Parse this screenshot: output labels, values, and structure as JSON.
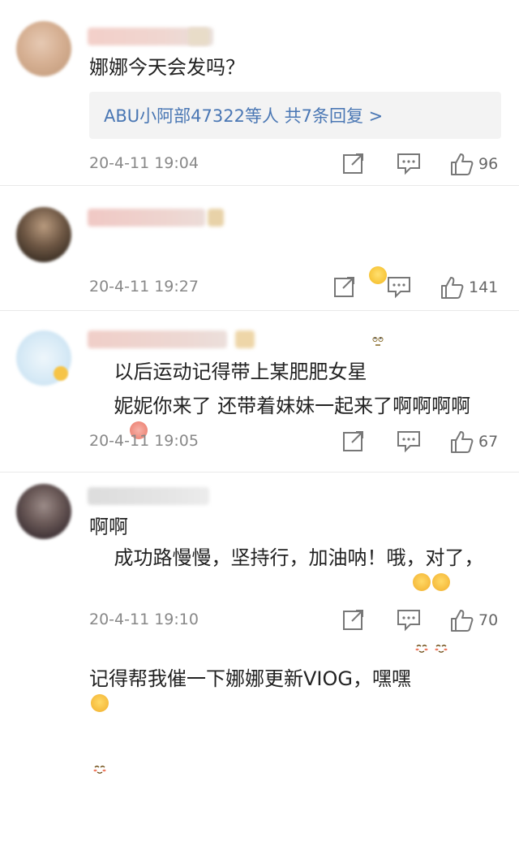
{
  "comments": [
    {
      "text": "娜娜今天会发吗？",
      "reply_summary": "ABU小阿部47322等人  共7条回复 >",
      "time": "20-4-11 19:04",
      "likes": "96"
    },
    {
      "text": "以后运动记得带上某肥肥女星",
      "time": "20-4-11 19:27",
      "likes": "141"
    },
    {
      "text": "妮妮你来了 还带着妹妹一起来了啊啊啊啊\n啊啊",
      "time": "20-4-11 19:05",
      "likes": "67"
    },
    {
      "text": "成功路慢慢，坚持行，加油呐！哦，对了，\n记得帮我催一下娜娜更新VIOG，嘿嘿",
      "time": "20-4-11 19:10",
      "likes": "70"
    }
  ],
  "colors": {
    "link": "#4a77b4",
    "meta_text": "#888888",
    "divider": "#e9e9e9",
    "reply_bg": "#f3f3f3"
  },
  "icons": [
    "share-icon",
    "comment-icon",
    "thumbs-up-icon",
    "eye-roll-emoji",
    "pig-emoji",
    "blush-emoji"
  ]
}
